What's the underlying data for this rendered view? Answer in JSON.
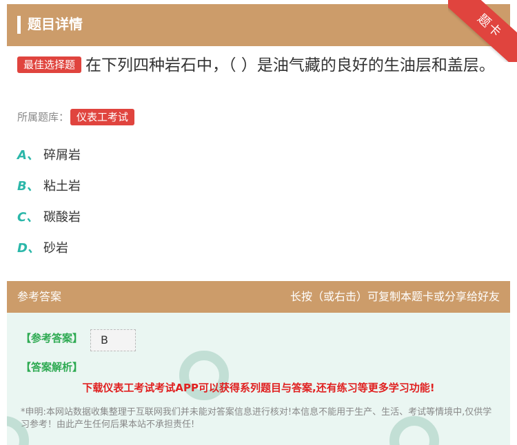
{
  "header": {
    "title": "题目详情",
    "ribbon": "题卡"
  },
  "question": {
    "tag": "最佳选择题",
    "text": "在下列四种岩石中，（ ）是油气藏的良好的生油层和盖层。"
  },
  "bank": {
    "label": "所属题库：",
    "name": "仪表工考试"
  },
  "options": [
    {
      "letter": "A、",
      "text": "碎屑岩"
    },
    {
      "letter": "B、",
      "text": "粘土岩"
    },
    {
      "letter": "C、",
      "text": "碳酸岩"
    },
    {
      "letter": "D、",
      "text": "砂岩"
    }
  ],
  "answer_section": {
    "title": "参考答案",
    "hint": "长按（或右击）可复制本题卡或分享给好友",
    "answer_label": "【参考答案】",
    "answer_value": "B",
    "analysis_label": "【答案解析】",
    "promo": "下载仪表工考试考试APP可以获得系列题目与答案,还有练习等更多学习功能!",
    "disclaimer": "*申明:本网站数据收集整理于互联网我们并未能对答案信息进行核对!本信息不能用于生产、生活、考试等情境中,仅供学习参考！由此产生任何后果本站不承担责任!"
  },
  "colors": {
    "accent": "#cc9c6a",
    "tag": "#e0443e",
    "option_letter": "#2bb7a9",
    "promo": "#e02020"
  }
}
